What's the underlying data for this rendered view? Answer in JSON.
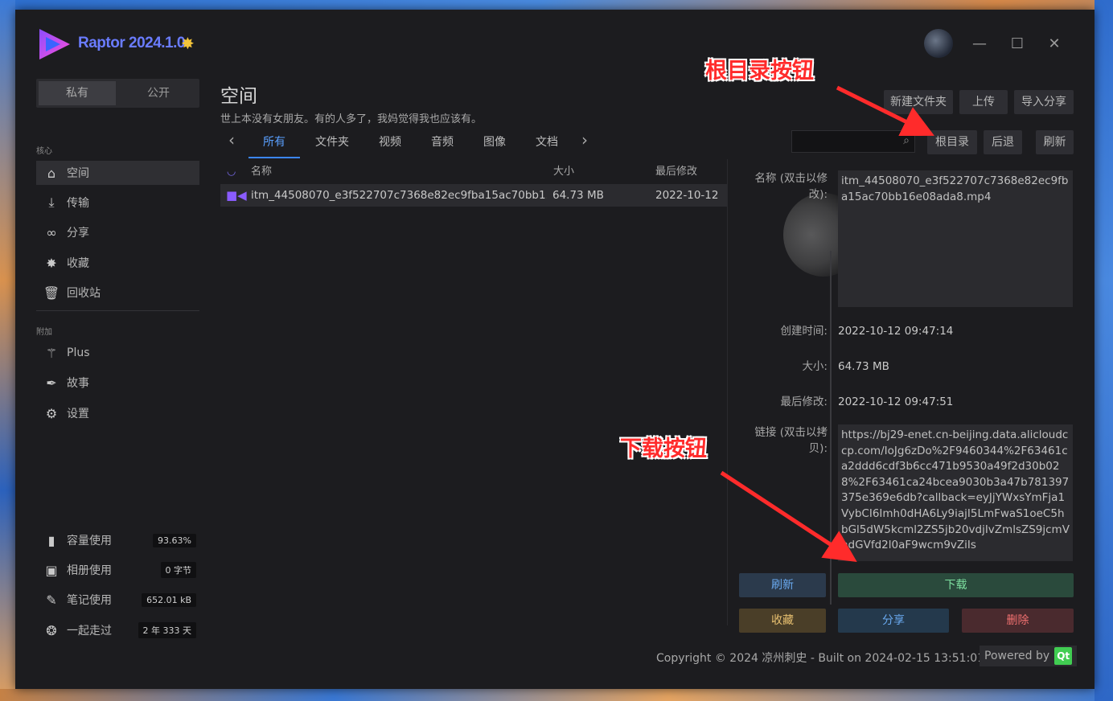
{
  "app": {
    "title": "Raptor 2024.1.0"
  },
  "titlebar": {
    "minimize": "—",
    "maximize": "☐",
    "close": "✕"
  },
  "sidebar": {
    "segment": {
      "private": "私有",
      "public": "公开"
    },
    "core_title": "核心",
    "core_items": [
      {
        "label": "空间",
        "icon": "home-icon"
      },
      {
        "label": "传输",
        "icon": "download-icon"
      },
      {
        "label": "分享",
        "icon": "link-icon"
      },
      {
        "label": "收藏",
        "icon": "star-icon"
      },
      {
        "label": "回收站",
        "icon": "trash-icon"
      }
    ],
    "extra_title": "附加",
    "extra_items": [
      {
        "label": "Plus",
        "icon": "magic-wand-icon"
      },
      {
        "label": "故事",
        "icon": "feather-icon"
      },
      {
        "label": "设置",
        "icon": "gear-icon"
      }
    ],
    "usage": [
      {
        "label": "容量使用",
        "value": "93.63%",
        "icon": "bar-chart-icon"
      },
      {
        "label": "相册使用",
        "value": "0 字节",
        "icon": "image-icon"
      },
      {
        "label": "笔记使用",
        "value": "652.01 kB",
        "icon": "pen-icon"
      },
      {
        "label": "一起走过",
        "value": "2 年 333 天",
        "icon": "medal-icon"
      }
    ]
  },
  "main": {
    "title": "空间",
    "subtitle": "世上本没有女朋友。有的人多了，我妈觉得我也应该有。",
    "tabs": [
      "所有",
      "文件夹",
      "视频",
      "音频",
      "图像",
      "文档"
    ],
    "columns": {
      "name": "名称",
      "size": "大小",
      "modified": "最后修改"
    },
    "files": [
      {
        "name": "itm_44508070_e3f522707c7368e82ec9fba15ac70bb1...",
        "size": "64.73 MB",
        "modified": "2022-10-12"
      }
    ]
  },
  "toolbar": {
    "new_folder": "新建文件夹",
    "upload": "上传",
    "import_share": "导入分享",
    "root": "根目录",
    "back": "后退",
    "refresh": "刷新"
  },
  "details": {
    "name_label": "名称 (双击以修改):",
    "name_value": "itm_44508070_e3f522707c7368e82ec9fba15ac70bb16e08ada8.mp4",
    "created_label": "创建时间:",
    "created_value": "2022-10-12 09:47:14",
    "size_label": "大小:",
    "size_value": "64.73 MB",
    "modified_label": "最后修改:",
    "modified_value": "2022-10-12 09:47:51",
    "link_label": "链接 (双击以拷贝):",
    "link_value": "https://bj29-enet.cn-beijing.data.alicloudccp.com/IoJg6zDo%2F9460344%2F63461ca2ddd6cdf3b6cc471b9530a49f2d30b028%2F63461ca24bcea9030b3a47b781397375e369e6db?callback=eyJjYWxsYmFja1VybCI6Imh0dHA6Ly9iajI5LmFwaS1oeC5hbGl5dW5kcml2ZS5jb20vdjIvZmlsZS9jcmVhdGVfd2l0aF9wcm9vZiIs"
  },
  "actions": {
    "refresh": "刷新",
    "download": "下载",
    "favorite": "收藏",
    "share": "分享",
    "delete": "删除"
  },
  "footer": {
    "copyright": "Copyright © 2024 凉州刺史 - Built on 2024-02-15 13:51:01",
    "powered_by": "Powered by",
    "qt": "Qt"
  },
  "annotations": {
    "root_button": "根目录按钮",
    "download_button": "下载按钮"
  },
  "colors": {
    "accent": "#3b86ff",
    "download_bg": "#2a4a3c",
    "delete_bg": "#4a2a2e",
    "annotation": "#ff2b2b"
  }
}
